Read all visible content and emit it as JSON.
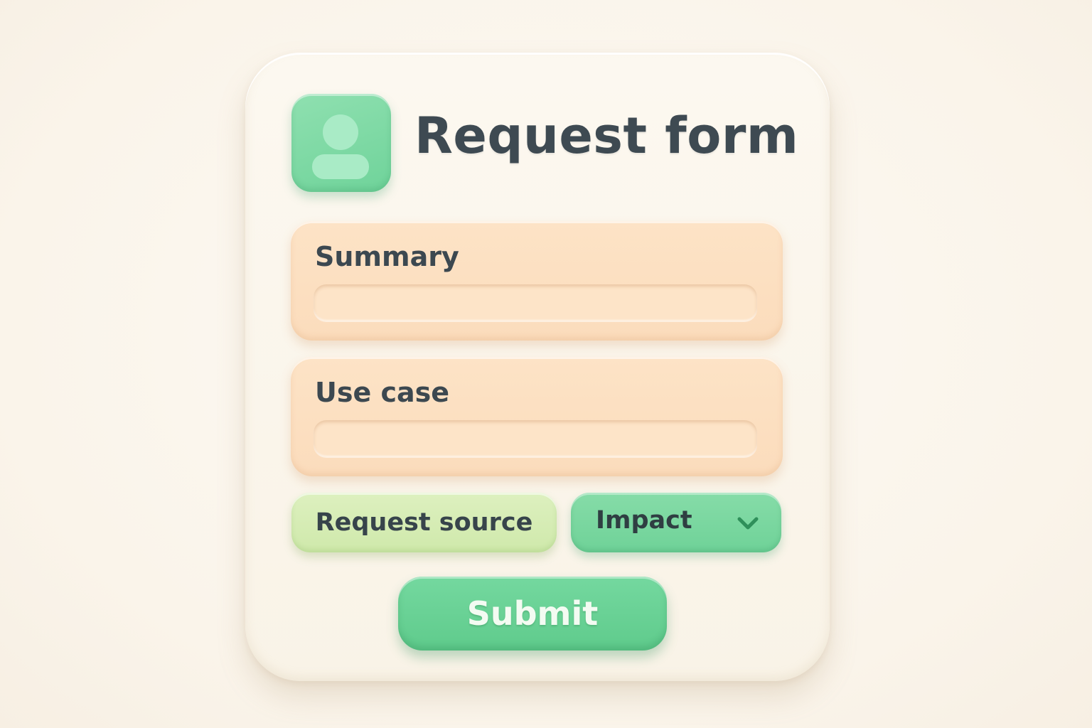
{
  "form": {
    "title": "Request form",
    "avatar_icon": "user-icon",
    "fields": [
      {
        "label": "Summary",
        "value": "",
        "placeholder": ""
      },
      {
        "label": "Use case",
        "value": "",
        "placeholder": ""
      }
    ],
    "request_source_label": "Request source",
    "impact": {
      "selected": "Impact",
      "icon": "chevron-down-icon"
    },
    "submit_label": "Submit"
  },
  "colors": {
    "background": "#faf4ea",
    "card": "#fbf6ec",
    "accent_green": "#6fd39a",
    "field_peach": "#fcdfc1",
    "light_green": "#d6edb5",
    "text_dark": "#3e4a52"
  }
}
